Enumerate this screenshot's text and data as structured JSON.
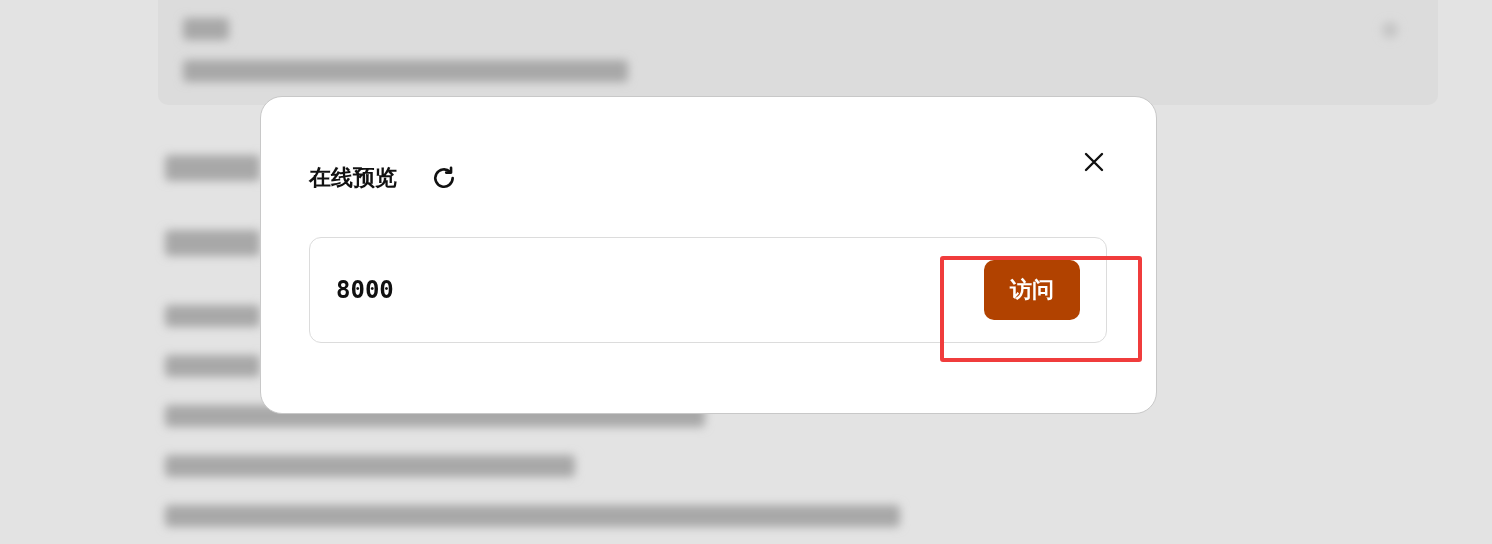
{
  "dialog": {
    "title": "在线预览",
    "port_field": {
      "value": "8000"
    },
    "visit_button": {
      "label": "访问",
      "highlighted": true
    }
  }
}
